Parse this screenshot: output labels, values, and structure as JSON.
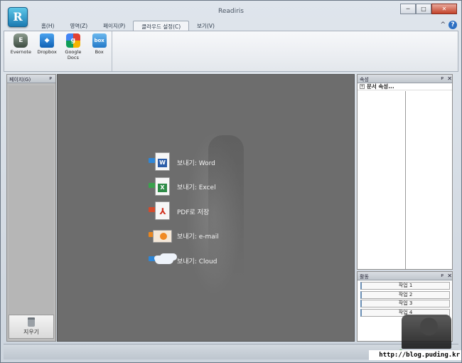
{
  "window": {
    "title": "Readiris"
  },
  "app_icon": {
    "glyph": "R"
  },
  "window_controls": {
    "minimize": "─",
    "maximize": "□",
    "close": "✕"
  },
  "ribbon_tabs": [
    {
      "label": "홈(H)",
      "active": false
    },
    {
      "label": "영역(Z)",
      "active": false
    },
    {
      "label": "페이지(P)",
      "active": false
    },
    {
      "label": "클라우드 설정(C)",
      "active": true
    },
    {
      "label": "보기(V)",
      "active": false
    }
  ],
  "help": {
    "caret": "^",
    "icon": "?"
  },
  "ribbon_buttons": [
    {
      "label": "Evernote",
      "icon": "evernote-icon",
      "glyph": "E"
    },
    {
      "label": "Dropbox",
      "icon": "dropbox-icon",
      "glyph": "◆"
    },
    {
      "label": "Google Docs",
      "icon": "google-docs-icon",
      "glyph": "g"
    },
    {
      "label": "Box",
      "icon": "box-icon",
      "glyph": "box"
    }
  ],
  "left_pane": {
    "title": "페이지(G)",
    "pin": "ᴘ",
    "delete_label": "지우기"
  },
  "actions": [
    {
      "label": "보내기: Word",
      "icon": "word-icon",
      "glyph": "W",
      "arrow": "blue"
    },
    {
      "label": "보내기: Excel",
      "icon": "excel-icon",
      "glyph": "X",
      "arrow": "green"
    },
    {
      "label": "PDF로 저장",
      "icon": "pdf-icon",
      "glyph": "⅄",
      "arrow": "red"
    },
    {
      "label": "보내기: e-mail",
      "icon": "mail-icon",
      "glyph": "",
      "arrow": "orange"
    },
    {
      "label": "보내기: Cloud",
      "icon": "cloud-icon",
      "glyph": "",
      "arrow": "blue"
    }
  ],
  "properties_pane": {
    "title": "속성",
    "pin": "ᴘ",
    "close": "✕",
    "row_label": "문서 속성...",
    "expander": "+"
  },
  "activity_pane": {
    "title": "활동",
    "pin": "ᴘ",
    "close": "✕",
    "jobs": [
      "작업 1",
      "작업 2",
      "작업 3",
      "작업 4"
    ]
  },
  "watermark": {
    "text": "http://blog.puding.kr"
  },
  "colors": {
    "accent": "#2d6fc2",
    "canvas": "#6d6d6d",
    "ribbon": "#e3e7ec"
  }
}
